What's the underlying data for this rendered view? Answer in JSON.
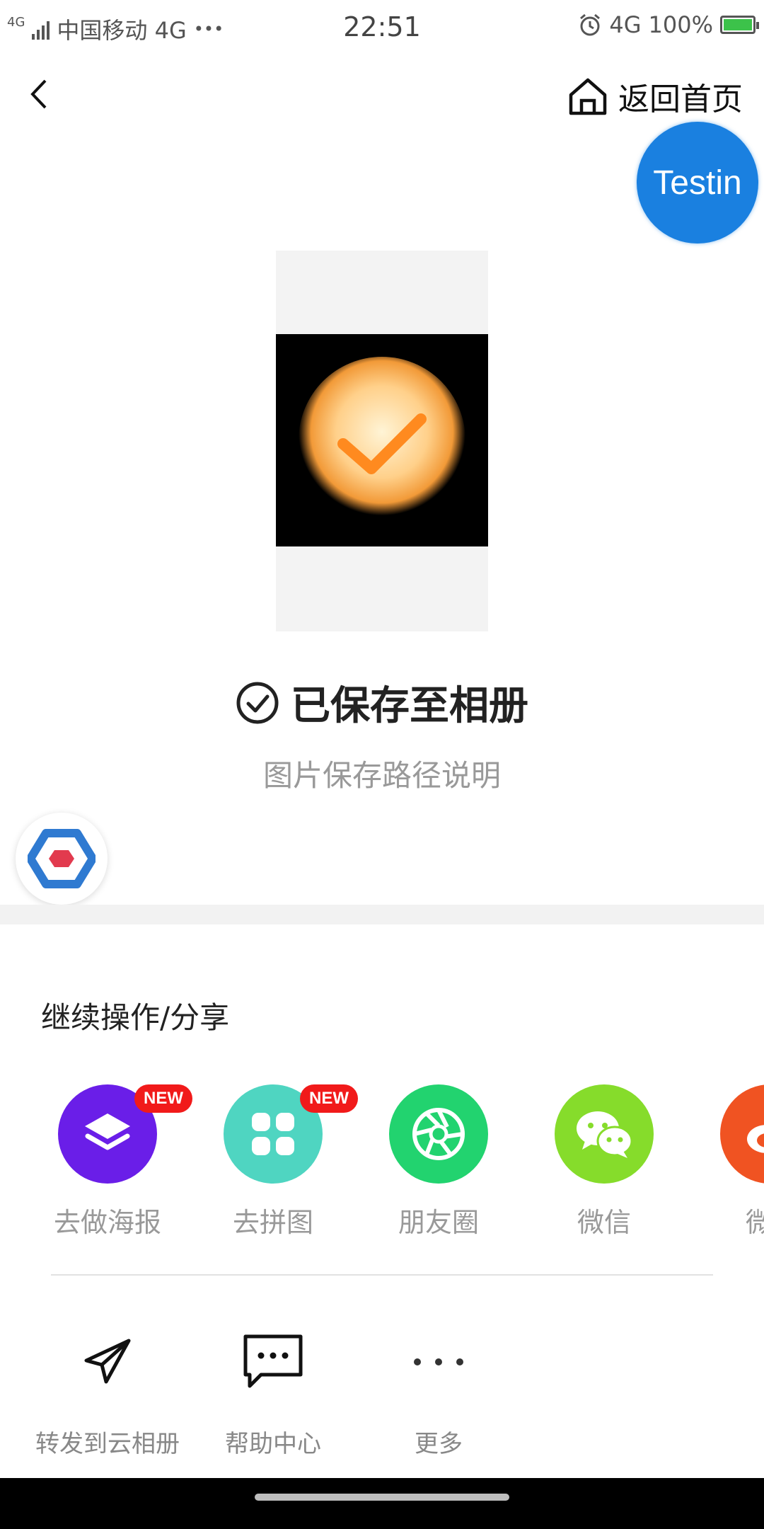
{
  "status_bar": {
    "net_small": "4G",
    "carrier": "中国移动 4G",
    "dots": "•••",
    "time": "22:51",
    "network": "4G",
    "battery": "100%"
  },
  "header": {
    "home_label": "返回首页"
  },
  "testin_badge": "Testin",
  "saved": {
    "title": "已保存至相册",
    "subtitle": "图片保存路径说明"
  },
  "share_section": {
    "title": "继续操作/分享",
    "items": [
      {
        "label": "去做海报",
        "badge": "NEW",
        "color": "#6a1ee8",
        "icon": "layers-icon"
      },
      {
        "label": "去拼图",
        "badge": "NEW",
        "color": "#4fd5c1",
        "icon": "grid-icon"
      },
      {
        "label": "朋友圈",
        "badge": "",
        "color": "#22d36f",
        "icon": "aperture-icon"
      },
      {
        "label": "微信",
        "badge": "",
        "color": "#86dc2b",
        "icon": "wechat-icon"
      },
      {
        "label": "微",
        "badge": "",
        "color": "#f05322",
        "icon": "weibo-icon"
      }
    ]
  },
  "actions": [
    {
      "label": "转发到云相册",
      "icon": "send-icon"
    },
    {
      "label": "帮助中心",
      "icon": "chat-help-icon"
    },
    {
      "label": "更多",
      "icon": "more-icon"
    }
  ]
}
